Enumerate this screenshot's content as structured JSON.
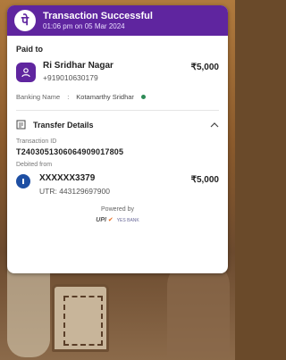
{
  "header": {
    "title": "Transaction Successful",
    "subtitle": "01:06 pm on 05 Mar 2024",
    "logo_glyph": "पे",
    "color": "#5f259f"
  },
  "paid_to": {
    "label": "Paid to",
    "name": "Ri Sridhar Nagar",
    "phone": "+919010630179",
    "amount": "₹5,000"
  },
  "banking": {
    "label": "Banking Name",
    "separator": ":",
    "name": "Kotamarthy  Sridhar",
    "verified_color": "#2e8b57"
  },
  "transfer": {
    "title": "Transfer Details",
    "transaction_id_label": "Transaction ID",
    "transaction_id": "T2403051306064909017805",
    "debited_from_label": "Debited from",
    "account": "XXXXXX3379",
    "utr": "UTR: 443129697900",
    "amount": "₹5,000"
  },
  "footer": {
    "powered_by": "Powered by",
    "upi_text": "UPI",
    "upi_tick": "✔",
    "upi_sub": "YES BANK"
  },
  "icons": [
    "phonepe-logo",
    "user-icon",
    "document-icon",
    "chevron-up-icon",
    "bank-icon",
    "verified-dot-icon"
  ]
}
